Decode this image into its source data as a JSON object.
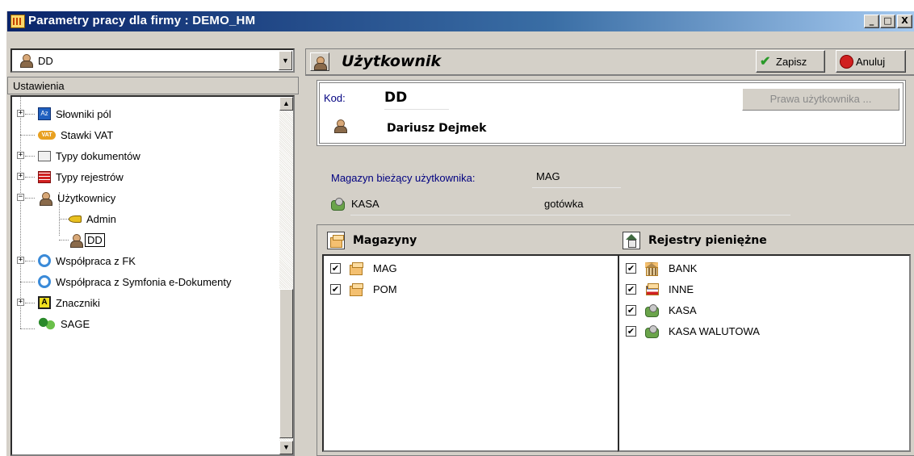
{
  "window": {
    "title": "Parametry pracy dla firmy : DEMO_HM"
  },
  "titlebar_buttons": {
    "minimize": "_",
    "maximize": "□",
    "close": "X"
  },
  "left": {
    "user_combo": {
      "value": "DD"
    },
    "settings_header": "Ustawienia",
    "tree": {
      "slowniki": "Słowniki pól",
      "stawki": "Stawki VAT",
      "typy_dok": "Typy dokumentów",
      "typy_rej": "Typy rejestrów",
      "uzytkownicy": "Użytkownicy",
      "admin": "Admin",
      "dd": "DD",
      "wsp_fk": "Współpraca z FK",
      "wsp_sym": "Współpraca z Symfonia e-Dokumenty",
      "znaczniki": "Znaczniki",
      "sage": "SAGE"
    }
  },
  "right": {
    "title": "Użytkownik",
    "save_label": "Zapisz",
    "cancel_label": "Anuluj",
    "kod_label": "Kod:",
    "kod_value": "DD",
    "full_name": "Dariusz Dejmek",
    "rights_button": "Prawa użytkownika ...",
    "magazyn_label": "Magazyn bieżący użytkownika:",
    "magazyn_value": "MAG",
    "kasa_label": "KASA",
    "kasa_value": "gotówka",
    "magazyny_header": "Magazyny",
    "rejestry_header": "Rejestry pieniężne",
    "magazyny": [
      {
        "label": "MAG",
        "checked": true
      },
      {
        "label": "POM",
        "checked": true
      }
    ],
    "rejestry": [
      {
        "label": "BANK",
        "checked": true,
        "icon": "bank-icon"
      },
      {
        "label": "INNE",
        "checked": true,
        "icon": "flag-icon"
      },
      {
        "label": "KASA",
        "checked": true,
        "icon": "money-icon"
      },
      {
        "label": "KASA WALUTOWA",
        "checked": true,
        "icon": "money-icon"
      }
    ]
  }
}
